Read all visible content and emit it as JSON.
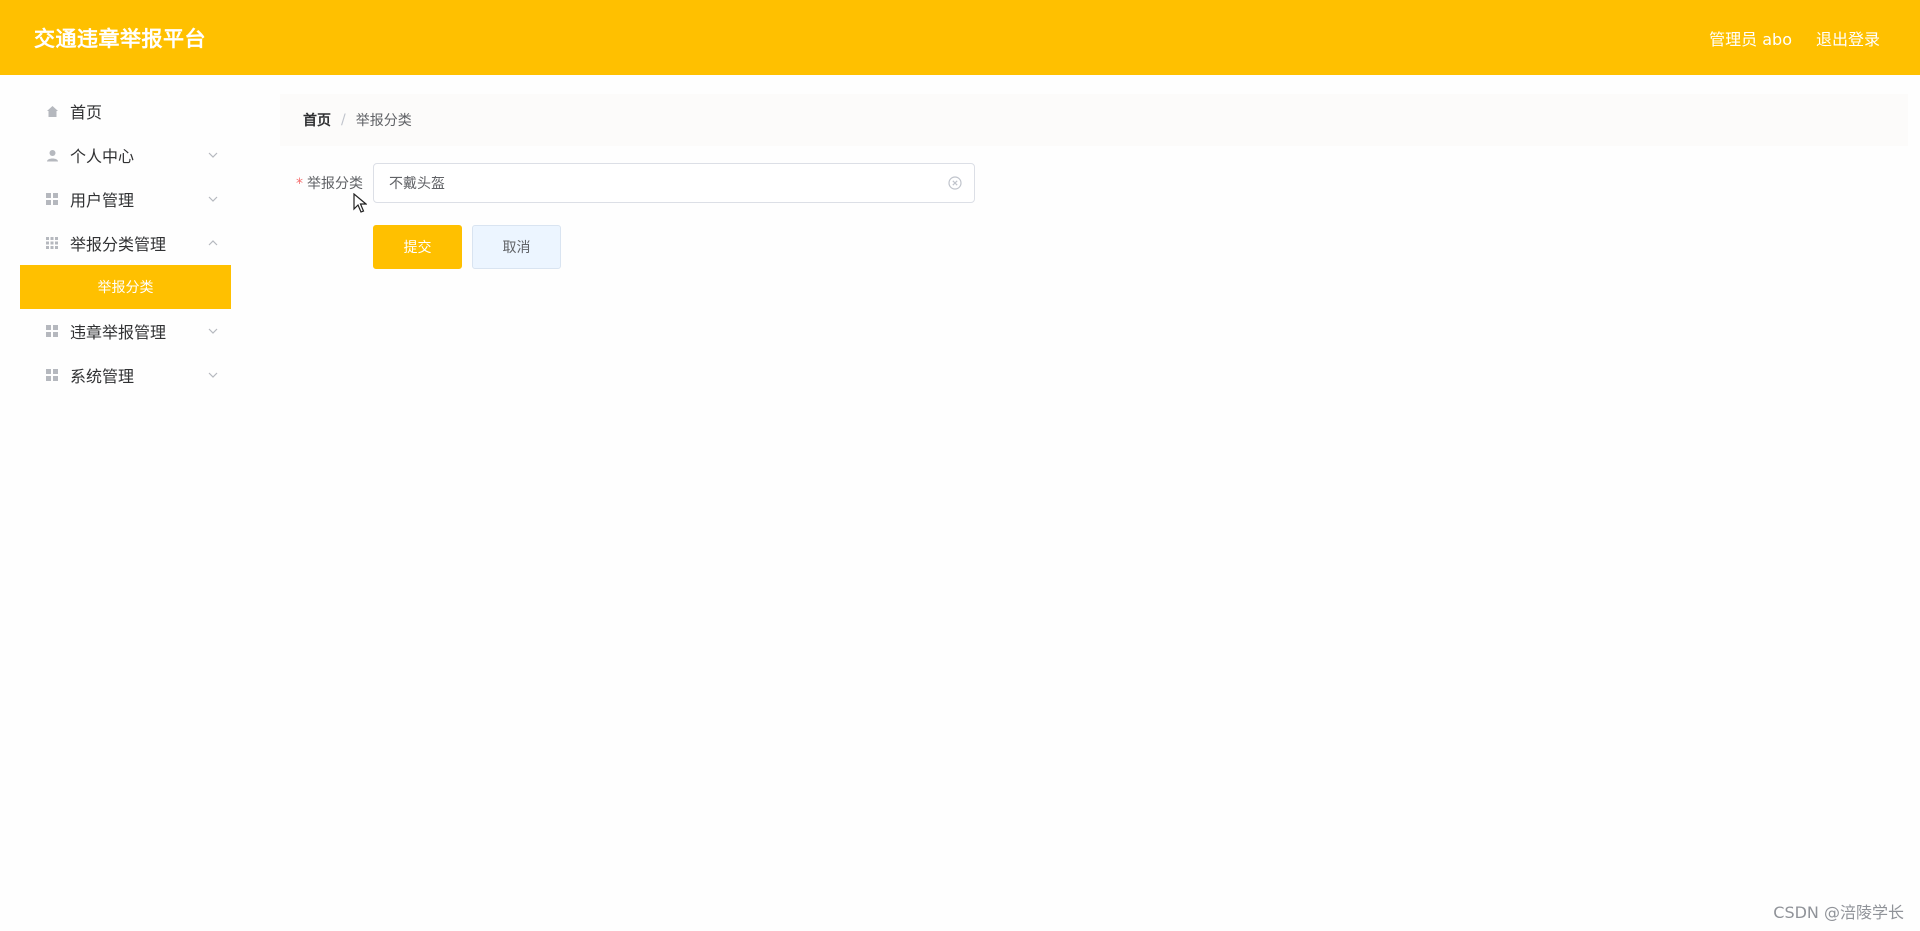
{
  "header": {
    "title": "交通违章举报平台",
    "user_text": "管理员 abo",
    "logout": "退出登录",
    "bg_color": "#ffc000"
  },
  "sidebar": {
    "items": [
      {
        "label": "首页",
        "icon": "home-icon"
      },
      {
        "label": "个人中心",
        "icon": "user-icon"
      },
      {
        "label": "用户管理",
        "icon": "grid-icon"
      },
      {
        "label": "举报分类管理",
        "icon": "grid-icon"
      },
      {
        "label": "违章举报管理",
        "icon": "grid-icon"
      },
      {
        "label": "系统管理",
        "icon": "grid-icon"
      }
    ],
    "active_sub": "举报分类"
  },
  "breadcrumb": {
    "home": "首页",
    "separator": "/",
    "current": "举报分类"
  },
  "form": {
    "label": "举报分类",
    "required_mark": "*",
    "value": "不戴头盔",
    "submit": "提交",
    "cancel": "取消"
  },
  "watermark": "CSDN @涪陵学长"
}
